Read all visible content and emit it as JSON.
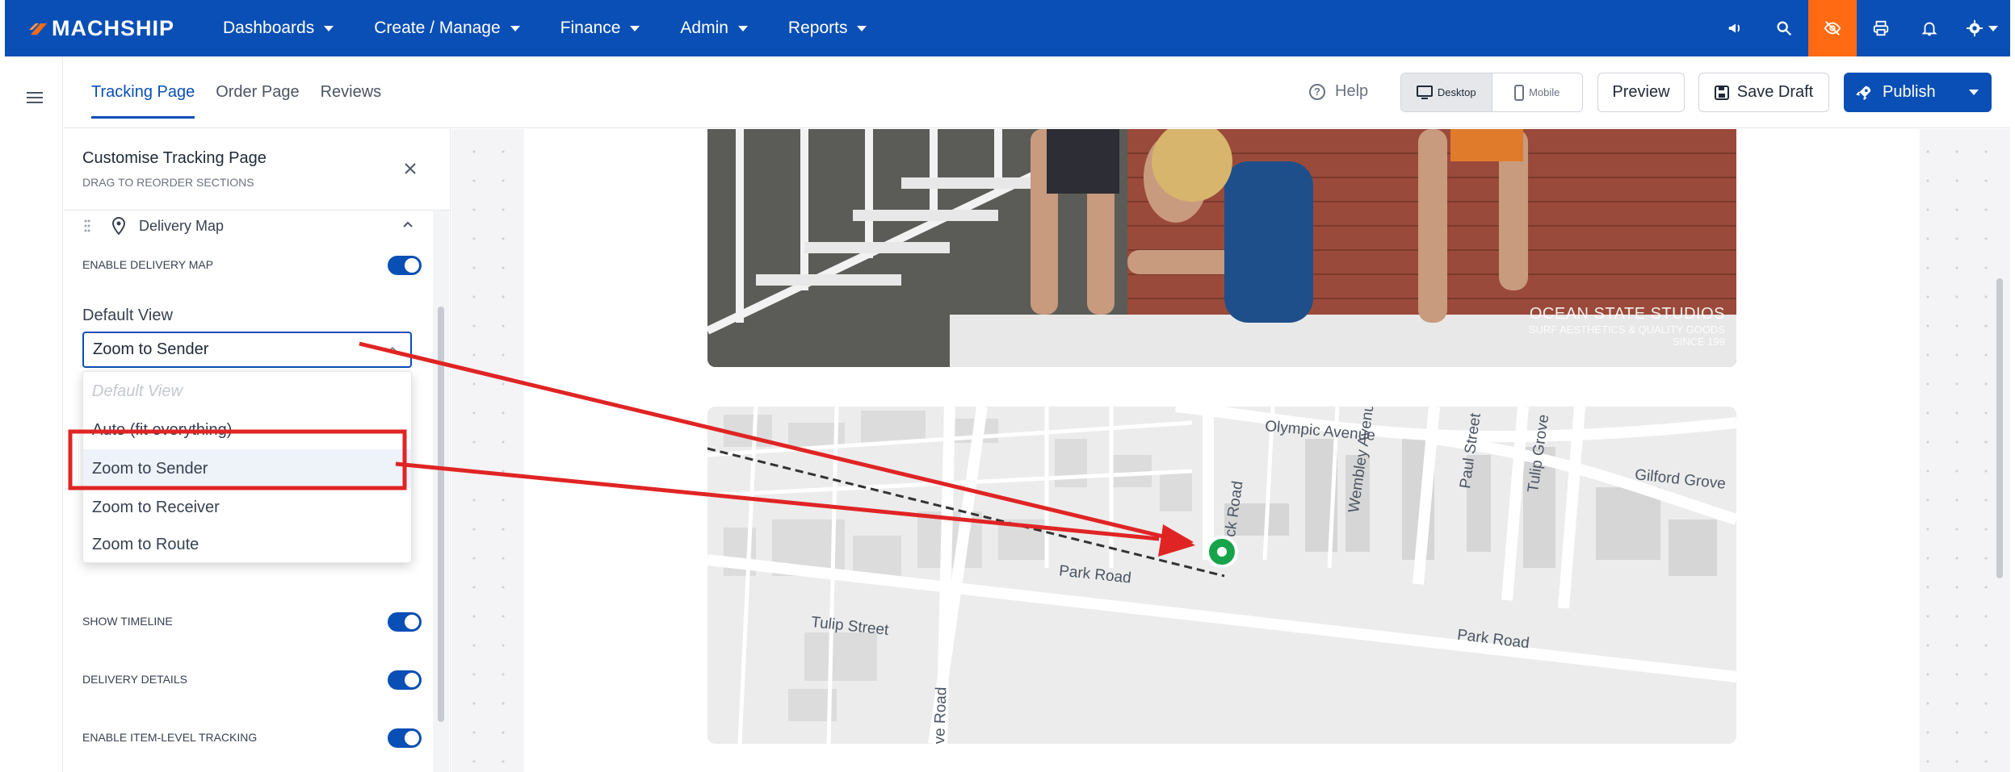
{
  "brand": {
    "name": "MACHSHIP"
  },
  "nav": {
    "items": [
      {
        "label": "Dashboards"
      },
      {
        "label": "Create / Manage"
      },
      {
        "label": "Finance"
      },
      {
        "label": "Admin"
      },
      {
        "label": "Reports"
      }
    ],
    "icons": [
      "megaphone-icon",
      "search-icon",
      "eye-off-icon",
      "printer-icon",
      "bell-icon",
      "gear-icon"
    ]
  },
  "tabs": [
    {
      "label": "Tracking Page",
      "active": true
    },
    {
      "label": "Order Page"
    },
    {
      "label": "Reviews"
    }
  ],
  "toolbar": {
    "help": "Help",
    "desktop": "Desktop",
    "mobile": "Mobile",
    "preview": "Preview",
    "save_draft": "Save Draft",
    "publish": "Publish"
  },
  "panel": {
    "title": "Customise Tracking Page",
    "subtitle": "DRAG TO REORDER SECTIONS",
    "section": "Delivery Map",
    "enable_map_label": "ENABLE DELIVERY MAP",
    "default_view_label": "Default View",
    "default_view_value": "Zoom to Sender",
    "options": [
      {
        "label": "Default View",
        "placeholder": true
      },
      {
        "label": "Auto (fit everything)"
      },
      {
        "label": "Zoom to Sender",
        "selected": true
      },
      {
        "label": "Zoom to Receiver"
      },
      {
        "label": "Zoom to Route"
      }
    ],
    "toggles": [
      {
        "label": "SHOW TIMELINE",
        "on": true
      },
      {
        "label": "DELIVERY DETAILS",
        "on": true
      },
      {
        "label": "ENABLE ITEM-LEVEL TRACKING",
        "on": true
      }
    ]
  },
  "hero": {
    "line1": "OCEAN STATE STUDIOS",
    "line2": "SURF AESTHETICS & QUALITY GOODS",
    "line3": "SINCE 199"
  },
  "map": {
    "streets": [
      "Olympic Avenue",
      "Park Road",
      "Tulip Street",
      "Wembley Avenue",
      "Paul Street",
      "Tulip Grove",
      "Gilford Grove",
      "Park Road",
      "ck Road",
      "ve Road"
    ]
  },
  "colors": {
    "brand_blue": "#0a4fb5",
    "accent_orange": "#ff6a13",
    "annotation_red": "#e02424",
    "marker_green": "#16a34a"
  }
}
